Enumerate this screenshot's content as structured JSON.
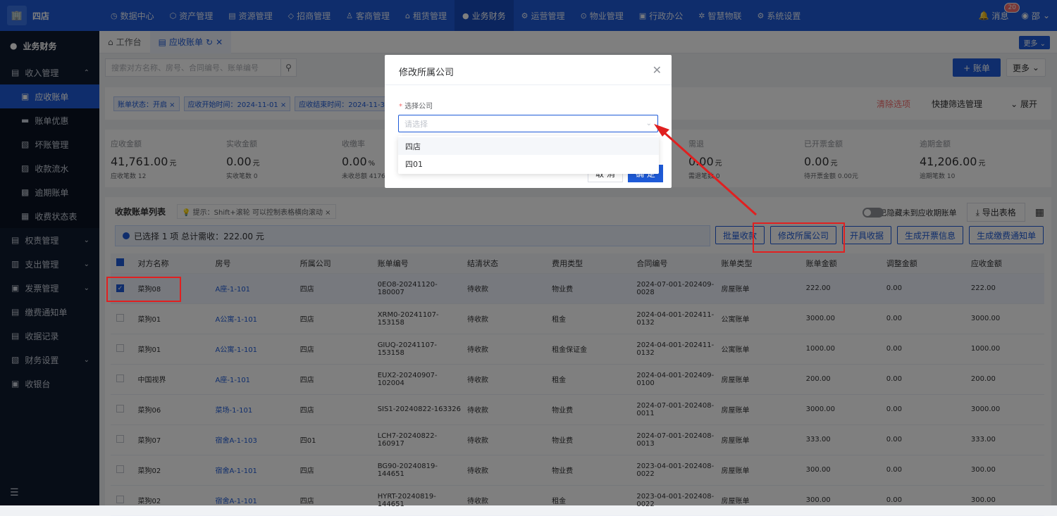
{
  "topbar": {
    "brand": "四店",
    "nav": [
      {
        "label": "数据中心",
        "icon": "◷"
      },
      {
        "label": "资产管理",
        "icon": "⬡"
      },
      {
        "label": "资源管理",
        "icon": "▤"
      },
      {
        "label": "招商管理",
        "icon": "◇"
      },
      {
        "label": "客商管理",
        "icon": "♙"
      },
      {
        "label": "租赁管理",
        "icon": "⌂"
      },
      {
        "label": "业务财务",
        "icon": "●",
        "active": true
      },
      {
        "label": "运营管理",
        "icon": "⚙"
      },
      {
        "label": "物业管理",
        "icon": "⊙"
      },
      {
        "label": "行政办公",
        "icon": "▣"
      },
      {
        "label": "智慧物联",
        "icon": "✲"
      },
      {
        "label": "系统设置",
        "icon": "⚙"
      }
    ],
    "message_label": "消息",
    "message_count": "20",
    "user_label": "邵"
  },
  "sidebar": {
    "header": "业务财务",
    "items": [
      {
        "label": "收入管理",
        "icon": "▤",
        "caret": "^",
        "type": "group"
      },
      {
        "label": "应收账单",
        "icon": "▣",
        "type": "sub",
        "active": true
      },
      {
        "label": "账单优惠",
        "icon": "▬",
        "type": "sub"
      },
      {
        "label": "坏账管理",
        "icon": "▧",
        "type": "sub"
      },
      {
        "label": "收款流水",
        "icon": "▨",
        "type": "sub"
      },
      {
        "label": "逾期账单",
        "icon": "▩",
        "type": "sub"
      },
      {
        "label": "收费状态表",
        "icon": "▦",
        "type": "sub"
      },
      {
        "label": "权责管理",
        "icon": "▤",
        "caret": "v",
        "type": "group"
      },
      {
        "label": "支出管理",
        "icon": "▥",
        "caret": "v",
        "type": "group"
      },
      {
        "label": "发票管理",
        "icon": "▣",
        "caret": "v",
        "type": "group"
      },
      {
        "label": "缴费通知单",
        "icon": "▤",
        "type": "group"
      },
      {
        "label": "收据记录",
        "icon": "▤",
        "type": "group"
      },
      {
        "label": "财务设置",
        "icon": "▧",
        "caret": "v",
        "type": "group"
      },
      {
        "label": "收银台",
        "icon": "▣",
        "type": "group"
      }
    ]
  },
  "tabs": {
    "workbench": "工作台",
    "current": "应收账单",
    "more": "更多"
  },
  "search": {
    "placeholder": "搜索对方名称、房号、合同编号、账单编号",
    "add_label": "+ 账单",
    "more_label": "更多"
  },
  "filters": {
    "tags": [
      "账单状态：开启",
      "应收开始时间：2024-11-01",
      "应收结束时间：2024-11-30"
    ],
    "clear": "清除选项",
    "quick": "快捷筛选管理",
    "expand": "展开"
  },
  "stats": [
    {
      "label": "应收金额",
      "value": "41,761.00",
      "unit": "元",
      "sub": "应收笔数 12"
    },
    {
      "label": "实收金额",
      "value": "0.00",
      "unit": "元",
      "sub": "实收笔数 0"
    },
    {
      "label": "收缴率",
      "value": "0.00",
      "unit": "%",
      "sub": "未收总额 4176"
    },
    {
      "label": "",
      "value": "",
      "unit": "",
      "sub": ""
    },
    {
      "label": "",
      "value": "",
      "unit": "",
      "sub": ""
    },
    {
      "label": "需退",
      "value": "0.00",
      "unit": "元",
      "sub": "需退笔数 0"
    },
    {
      "label": "已开票金额",
      "value": "0.00",
      "unit": "元",
      "sub": "待开票金额 0.00元"
    },
    {
      "label": "逾期金额",
      "value": "41,206.00",
      "unit": "元",
      "sub": "逾期笔数 10"
    }
  ],
  "list": {
    "title": "收款账单列表",
    "hint": "提示：Shift+滚轮 可以控制表格横向滚动",
    "toggle_label": "隐藏",
    "toggle_desc": "已隐藏未到应收期账单",
    "export": "导出表格",
    "selection_text": "已选择 1 项  总计需收：222.00 元",
    "actions": [
      "批量收款",
      "修改所属公司",
      "开具收据",
      "生成开票信息",
      "生成缴费通知单"
    ],
    "columns": [
      "对方名称",
      "房号",
      "所属公司",
      "账单编号",
      "结清状态",
      "费用类型",
      "合同编号",
      "账单类型",
      "账单金额",
      "调整金额",
      "应收金额"
    ],
    "rows": [
      {
        "checked": true,
        "name": "菜狗08",
        "room": "A座-1-101",
        "company": "四店",
        "bill": "0EO8-20241120-180007",
        "status": "待收款",
        "fee": "物业费",
        "contract": "2024-07-001-202409-0028",
        "type": "房屋账单",
        "amount": "222.00",
        "adjust": "0.00",
        "due": "222.00"
      },
      {
        "checked": false,
        "name": "菜狗01",
        "room": "A公寓-1-101",
        "company": "四店",
        "bill": "XRM0-20241107-153158",
        "status": "待收款",
        "fee": "租金",
        "contract": "2024-04-001-202411-0132",
        "type": "公寓账单",
        "amount": "3000.00",
        "adjust": "0.00",
        "due": "3000.00"
      },
      {
        "checked": false,
        "name": "菜狗01",
        "room": "A公寓-1-101",
        "company": "四店",
        "bill": "GIUQ-20241107-153158",
        "status": "待收款",
        "fee": "租金保证金",
        "contract": "2024-04-001-202411-0132",
        "type": "公寓账单",
        "amount": "1000.00",
        "adjust": "0.00",
        "due": "1000.00"
      },
      {
        "checked": false,
        "name": "中国视界",
        "room": "A座-1-101",
        "company": "四店",
        "bill": "EUX2-20240907-102004",
        "status": "待收款",
        "fee": "租金",
        "contract": "2024-04-001-202409-0100",
        "type": "房屋账单",
        "amount": "200.00",
        "adjust": "0.00",
        "due": "200.00"
      },
      {
        "checked": false,
        "name": "菜狗06",
        "room": "菜场-1-101",
        "company": "四店",
        "bill": "SIS1-20240822-163326",
        "status": "待收款",
        "fee": "物业费",
        "contract": "2024-07-001-202408-0011",
        "type": "房屋账单",
        "amount": "3000.00",
        "adjust": "0.00",
        "due": "3000.00"
      },
      {
        "checked": false,
        "name": "菜狗07",
        "room": "宿舍A-1-103",
        "company": "四01",
        "bill": "LCH7-20240822-160917",
        "status": "待收款",
        "fee": "物业费",
        "contract": "2024-07-001-202408-0013",
        "type": "房屋账单",
        "amount": "333.00",
        "adjust": "0.00",
        "due": "333.00"
      },
      {
        "checked": false,
        "name": "菜狗02",
        "room": "宿舍A-1-101",
        "company": "四店",
        "bill": "BG90-20240819-144651",
        "status": "待收款",
        "fee": "物业费",
        "contract": "2023-04-001-202408-0022",
        "type": "房屋账单",
        "amount": "300.00",
        "adjust": "0.00",
        "due": "300.00"
      },
      {
        "checked": false,
        "name": "菜狗02",
        "room": "宿舍A-1-101",
        "company": "四店",
        "bill": "HYRT-20240819-144651",
        "status": "待收款",
        "fee": "租金",
        "contract": "2023-04-001-202408-0022",
        "type": "房屋账单",
        "amount": "300.00",
        "adjust": "0.00",
        "due": "300.00"
      }
    ]
  },
  "modal": {
    "title": "修改所属公司",
    "field_label": "选择公司",
    "placeholder": "请选择",
    "options": [
      "四店",
      "四01"
    ],
    "cancel": "取 消",
    "confirm": "确 定"
  },
  "colors": {
    "primary": "#1e5bd8",
    "annotation": "#e02020",
    "danger": "#f56c6c"
  }
}
